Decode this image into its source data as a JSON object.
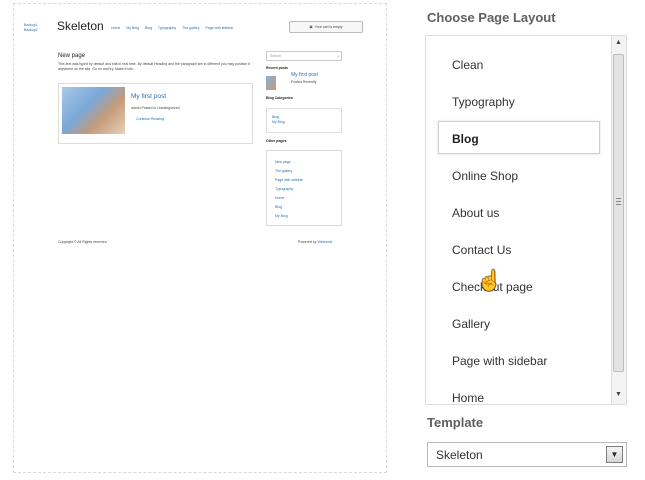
{
  "preview": {
    "header_left": [
      "Backup1",
      "Backup2"
    ],
    "logo": "Skeleton",
    "menu": [
      "Home",
      "My Blog",
      "Blog",
      "Typography",
      "The gallery",
      "Page with sidebar"
    ],
    "cart": "Your cart is empty",
    "page_title": "New page",
    "page_intro": "This text was typed by default and edit in real time. By default Heading and the paragraph are in different you may position it anywhere on the site. Go on and try. Make it lots.",
    "post_title": "My first post",
    "post_meta": "admin   Posted in Uncategorized",
    "post_link": "Continue Reading",
    "search_placeholder": "Search",
    "recent_posts_title": "Recent posts",
    "recent_post": "My first post",
    "recent_post_meta": "Posted Recently",
    "categories_title": "Blog Categories",
    "categories": [
      "Blog",
      "My Blog"
    ],
    "other_pages_title": "Other pages",
    "other_pages": [
      "New page",
      "The gallery",
      "Page with sidebar",
      "Typography",
      "Home",
      "Blog",
      "My Blog"
    ],
    "footer_left": "Copyright © All Rights reserved",
    "footer_right_label": "Powered by",
    "footer_right_link": "Webnode"
  },
  "layout_panel": {
    "heading": "Choose Page Layout",
    "items": [
      "Clean",
      "Typography",
      "Blog",
      "Online Shop",
      "About us",
      "Contact Us",
      "Checkout page",
      "Gallery",
      "Page with sidebar",
      "Home"
    ],
    "selected": "Blog"
  },
  "template_panel": {
    "heading": "Template",
    "value": "Skeleton"
  },
  "icons": {
    "cursor": "hand-pointer-icon",
    "scroll_up": "chevron-up-icon",
    "scroll_down": "chevron-down-icon",
    "dropdown": "chevron-down-icon",
    "cart": "cart-icon",
    "search": "search-icon"
  }
}
